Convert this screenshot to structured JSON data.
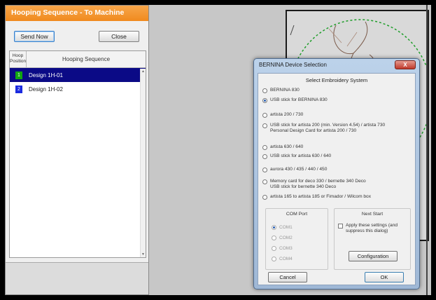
{
  "panel": {
    "title": "Hooping Sequence - To Machine",
    "send_label": "Send Now",
    "close_label": "Close",
    "header_position": "Hoop\nPosition",
    "header_sequence": "Hooping Sequence",
    "rows": [
      {
        "num": "1",
        "label": "Design 1H-01",
        "color": "#11a611",
        "selected": true
      },
      {
        "num": "2",
        "label": "Design 1H-02",
        "color": "#1b2be0",
        "selected": false
      }
    ]
  },
  "dialog": {
    "title": "BERNINA Device Selection",
    "close_glyph": "X",
    "heading": "Select Embroidery System",
    "options": [
      {
        "text": "BERNINA 830",
        "selected": false
      },
      {
        "text": "USB stick for BERNINA 830",
        "selected": true
      },
      {
        "text": "artista 200 / 730",
        "selected": false
      },
      {
        "text": "USB stick for artista 200 (min. Version 4.54) / artista 730\nPersonal Design Card for artista 200 / 730",
        "selected": false
      },
      {
        "text": "artista 630 / 640",
        "selected": false
      },
      {
        "text": "USB stick for artista 630 / 640",
        "selected": false
      },
      {
        "text": "aurora 430 / 435 / 440 / 450",
        "selected": false
      },
      {
        "text": "Memory card for deco 330 / bernette 340 Deco\nUSB stick for bernette 340 Deco",
        "selected": false
      },
      {
        "text": "artista 165 to artista 185 or Fimador / Wilcom box",
        "selected": false
      }
    ],
    "com_title": "COM Port",
    "com_ports": [
      "COM1",
      "COM2",
      "COM3",
      "COM4"
    ],
    "next_start_title": "Next Start",
    "next_start_checkbox": "Apply these settings (and\nsuppress this dialog)",
    "configuration_label": "Configuration",
    "cancel_label": "Cancel",
    "ok_label": "OK"
  },
  "colors": {
    "title_orange": "#f08a1e",
    "selection_navy": "#0b0a86",
    "hoop_green": "#1f9e2a"
  }
}
